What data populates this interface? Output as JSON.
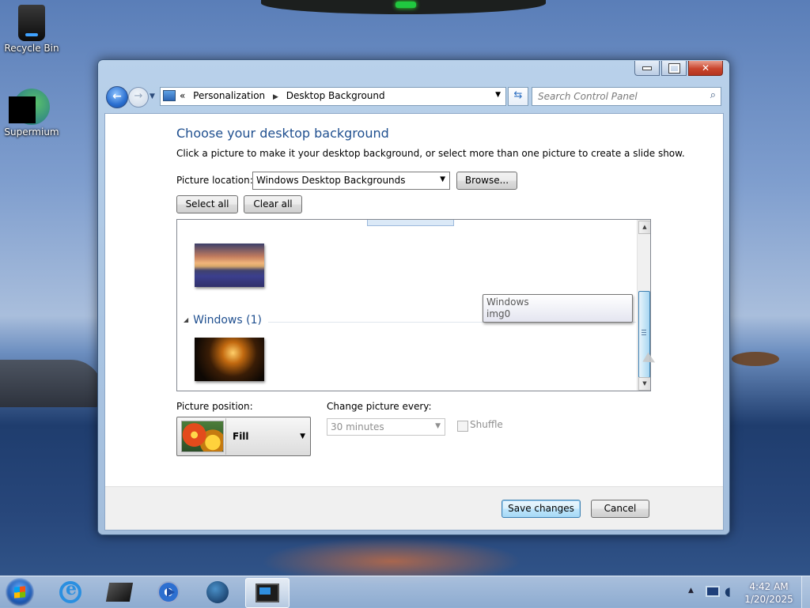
{
  "desktop": {
    "icons": [
      {
        "label": "Recycle Bin",
        "icon": "recycle-bin-icon"
      },
      {
        "label": "Supermium",
        "icon": "supermium-icon"
      }
    ]
  },
  "window": {
    "caption": {
      "minimize": "minimize",
      "maximize": "maximize",
      "close_glyph": "✕"
    },
    "breadcrumb": {
      "prefix": "«",
      "items": [
        "Personalization",
        "Desktop Background"
      ]
    },
    "search": {
      "placeholder": "Search Control Panel"
    }
  },
  "page": {
    "title": "Choose your desktop background",
    "description": "Click a picture to make it your desktop background, or select more than one picture to create a slide show.",
    "picture_location": {
      "label": "Picture location:",
      "value": "Windows Desktop Backgrounds",
      "browse_label": "Browse..."
    },
    "select_all_label": "Select all",
    "clear_all_label": "Clear all",
    "gallery": {
      "group_label": "Windows (1)",
      "tooltip": {
        "line1": "Windows",
        "line2": "img0"
      }
    },
    "picture_position": {
      "label": "Picture position:",
      "value": "Fill"
    },
    "change_picture": {
      "label": "Change picture every:",
      "value": "30 minutes"
    },
    "shuffle_label": "Shuffle",
    "save_label": "Save changes",
    "cancel_label": "Cancel"
  },
  "taskbar": {
    "apps": [
      "start-orb",
      "internet-explorer-icon",
      "dark-box-app-icon",
      "media-player-icon",
      "globe-app-icon",
      "display-app-icon"
    ],
    "clock": {
      "time": "4:42 AM",
      "date": "1/20/2025"
    }
  }
}
